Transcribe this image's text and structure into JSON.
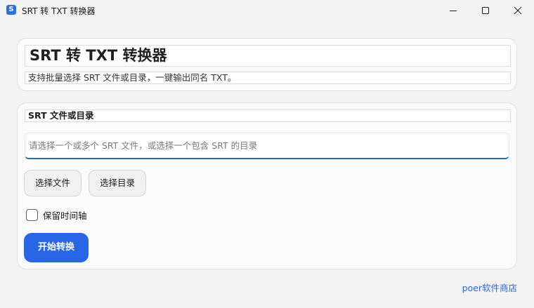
{
  "window": {
    "app_icon_letter": "S",
    "title": "SRT 转 TXT 转换器",
    "controls": [
      "minimize-icon",
      "maximize-icon",
      "close-icon"
    ]
  },
  "header": {
    "title": "SRT 转 TXT 转换器",
    "subtitle": "支持批量选择 SRT 文件或目录，一键输出同名 TXT。"
  },
  "source": {
    "label": "SRT 文件或目录",
    "input_value": "",
    "input_placeholder": "请选择一个或多个 SRT 文件，或选择一个包含 SRT 的目录",
    "choose_files_label": "选择文件",
    "choose_dir_label": "选择目录"
  },
  "options": {
    "keep_timeline_label": "保留时间轴",
    "keep_timeline_checked": false
  },
  "actions": {
    "start_label": "开始转换"
  },
  "footer": {
    "link_text": "poer软件商店"
  },
  "colors": {
    "accent": "#2866e6",
    "input_underline": "#1f6fb8",
    "background": "#f3f3f3",
    "card": "#fbfbfb"
  }
}
